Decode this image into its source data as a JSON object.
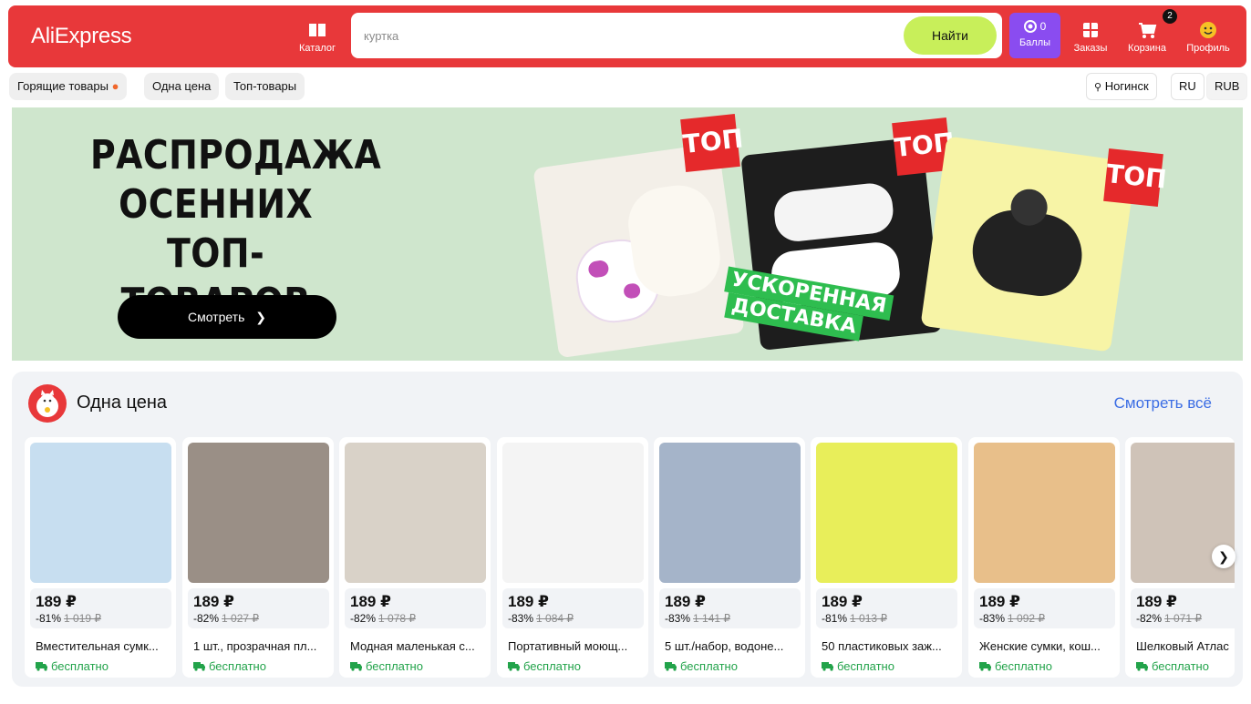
{
  "header": {
    "logo": "AliExpress",
    "catalog_label": "Каталог",
    "search": {
      "placeholder": "куртка",
      "button_label": "Найти"
    },
    "points": {
      "value": "0",
      "label": "Баллы"
    },
    "orders_label": "Заказы",
    "cart_label": "Корзина",
    "cart_count": "2",
    "profile_label": "Профиль",
    "colors": {
      "header_bg": "#e8383a",
      "search_button": "#c8ef5a",
      "points_bg": "#8a4cf0"
    }
  },
  "quick_links": [
    "Горящие товары",
    "Одна цена",
    "Топ-товары"
  ],
  "location": {
    "city": "Ногинск",
    "language": "RU",
    "currency": "RUB"
  },
  "banner": {
    "title_lines": [
      "РАСПРОДАЖА",
      "ОСЕННИХ ТОП-",
      "ТОВАРОВ"
    ],
    "button_label": "Смотреть",
    "tag_label": "ТОП",
    "shipping_lines": [
      "УСКОРЕННАЯ",
      "ДОСТАВКА"
    ]
  },
  "one_price": {
    "title": "Одна цена",
    "see_all": "Смотреть всё",
    "products": [
      {
        "price": "189 ₽",
        "discount": "-81%",
        "old_price": "1 019 ₽",
        "name": "Вместительная сумк...",
        "shipping": "бесплатно",
        "img_color": "#c7def0"
      },
      {
        "price": "189 ₽",
        "discount": "-82%",
        "old_price": "1 027 ₽",
        "name": "1 шт., прозрачная пл...",
        "shipping": "бесплатно",
        "img_color": "#9a8f86"
      },
      {
        "price": "189 ₽",
        "discount": "-82%",
        "old_price": "1 078 ₽",
        "name": "Модная маленькая с...",
        "shipping": "бесплатно",
        "img_color": "#d9d2c8"
      },
      {
        "price": "189 ₽",
        "discount": "-83%",
        "old_price": "1 084 ₽",
        "name": "Портативный моющ...",
        "shipping": "бесплатно",
        "img_color": "#f4f4f4"
      },
      {
        "price": "189 ₽",
        "discount": "-83%",
        "old_price": "1 141 ₽",
        "name": "5 шт./набор, водоне...",
        "shipping": "бесплатно",
        "img_color": "#a5b4c9"
      },
      {
        "price": "189 ₽",
        "discount": "-81%",
        "old_price": "1 013 ₽",
        "name": "50 пластиковых заж...",
        "shipping": "бесплатно",
        "img_color": "#e8ee5a"
      },
      {
        "price": "189 ₽",
        "discount": "-83%",
        "old_price": "1 092 ₽",
        "name": "Женские сумки, кош...",
        "shipping": "бесплатно",
        "img_color": "#e8bf8a"
      },
      {
        "price": "189 ₽",
        "discount": "-82%",
        "old_price": "1 071 ₽",
        "name": "Шелковый Атлас",
        "shipping": "бесплатно",
        "img_color": "#cfc3b8"
      }
    ]
  }
}
